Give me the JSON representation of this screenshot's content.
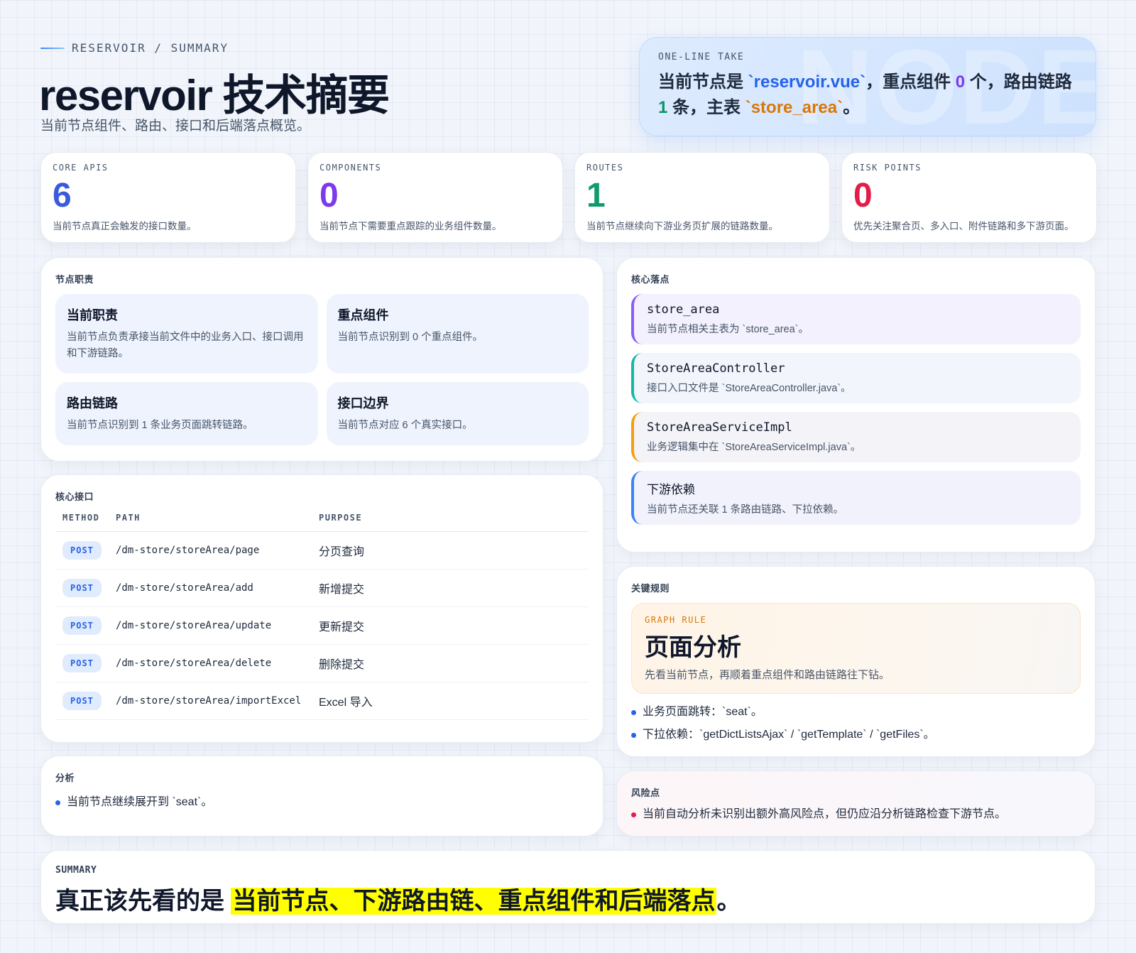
{
  "header": {
    "eyebrow": "RESERVOIR / SUMMARY",
    "title": "reservoir 技术摘要",
    "subtitle": "当前节点组件、路由、接口和后端落点概览。"
  },
  "take": {
    "label": "ONE-LINE TAKE",
    "watermark": "NODE",
    "parts": {
      "p1": "当前节点是 ",
      "file": "`reservoir.vue`",
      "p2": "，重点组件 ",
      "components": "0",
      "p3": " 个，路由链路 ",
      "routes": "1",
      "p4": " 条，主表 ",
      "table": "`store_area`",
      "p5": "。"
    }
  },
  "stats": [
    {
      "key": "CORE APIS",
      "value": "6",
      "desc": "当前节点真正会触发的接口数量。",
      "color": "#3b5bdb"
    },
    {
      "key": "COMPONENTS",
      "value": "0",
      "desc": "当前节点下需要重点跟踪的业务组件数量。",
      "color": "#7c3aed"
    },
    {
      "key": "ROUTES",
      "value": "1",
      "desc": "当前节点继续向下游业务页扩展的链路数量。",
      "color": "#0f9b6e"
    },
    {
      "key": "RISK POINTS",
      "value": "0",
      "desc": "优先关注聚合页、多入口、附件链路和多下游页面。",
      "color": "#e11d48"
    }
  ],
  "duties": {
    "title": "节点职责",
    "items": [
      {
        "title": "当前职责",
        "desc": "当前节点负责承接当前文件中的业务入口、接口调用和下游链路。"
      },
      {
        "title": "重点组件",
        "desc": "当前节点识别到 0 个重点组件。"
      },
      {
        "title": "路由链路",
        "desc": "当前节点识别到 1 条业务页面跳转链路。"
      },
      {
        "title": "接口边界",
        "desc": "当前节点对应 6 个真实接口。"
      }
    ]
  },
  "apis": {
    "title": "核心接口",
    "headers": {
      "method": "METHOD",
      "path": "PATH",
      "purpose": "PURPOSE"
    },
    "rows": [
      {
        "method": "POST",
        "path": "/dm-store/storeArea/page",
        "purpose": "分页查询"
      },
      {
        "method": "POST",
        "path": "/dm-store/storeArea/add",
        "purpose": "新增提交"
      },
      {
        "method": "POST",
        "path": "/dm-store/storeArea/update",
        "purpose": "更新提交"
      },
      {
        "method": "POST",
        "path": "/dm-store/storeArea/delete",
        "purpose": "删除提交"
      },
      {
        "method": "POST",
        "path": "/dm-store/storeArea/importExcel",
        "purpose": "Excel 导入"
      }
    ]
  },
  "analysis": {
    "title": "分析",
    "items": [
      "当前节点继续展开到 `seat`。"
    ]
  },
  "landing": {
    "title": "核心落点",
    "items": [
      {
        "title": "store_area",
        "desc": "当前节点相关主表为 `store_area`。"
      },
      {
        "title": "StoreAreaController",
        "desc": "接口入口文件是 `StoreAreaController.java`。"
      },
      {
        "title": "StoreAreaServiceImpl",
        "desc": "业务逻辑集中在 `StoreAreaServiceImpl.java`。"
      },
      {
        "title": "下游依赖",
        "desc": "当前节点还关联 1 条路由链路、下拉依赖。"
      }
    ]
  },
  "rules": {
    "title": "关键规则",
    "box_key": "GRAPH RULE",
    "box_title": "页面分析",
    "box_desc": "先看当前节点，再顺着重点组件和路由链路往下钻。",
    "items": [
      "业务页面跳转：`seat`。",
      "下拉依赖：`getDictListsAjax` / `getTemplate` / `getFiles`。"
    ]
  },
  "risks": {
    "title": "风险点",
    "items": [
      "当前自动分析未识别出额外高风险点，但仍应沿分析链路检查下游节点。"
    ]
  },
  "summary": {
    "label": "SUMMARY",
    "lead": "真正该先看的是 ",
    "highlight": "当前节点、下游路由链、重点组件和后端落点",
    "end": "。"
  }
}
